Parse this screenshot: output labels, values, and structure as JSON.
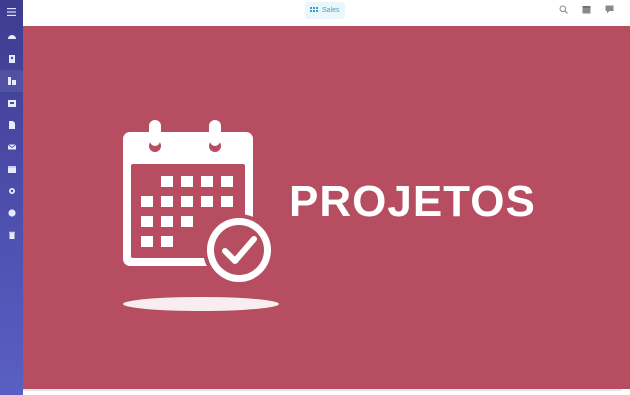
{
  "sidebar": {
    "menu_icon": "hamburger-icon",
    "items": [
      {
        "icon": "dashboard-icon"
      },
      {
        "icon": "contacts-icon"
      },
      {
        "icon": "reports-icon"
      },
      {
        "icon": "projects-icon"
      },
      {
        "icon": "documents-icon"
      },
      {
        "icon": "mail-icon"
      },
      {
        "icon": "calendar-icon"
      },
      {
        "icon": "settings-icon"
      },
      {
        "icon": "help-icon"
      },
      {
        "icon": "trash-icon"
      }
    ]
  },
  "topbar": {
    "app_label": "Sales",
    "app_icon": "apps-grid-icon",
    "right_icons": [
      "search-icon",
      "calendar-icon",
      "chat-icon"
    ]
  },
  "banner": {
    "title": "PROJETOS",
    "background": "#b64d61",
    "icon": "calendar-check-icon"
  }
}
